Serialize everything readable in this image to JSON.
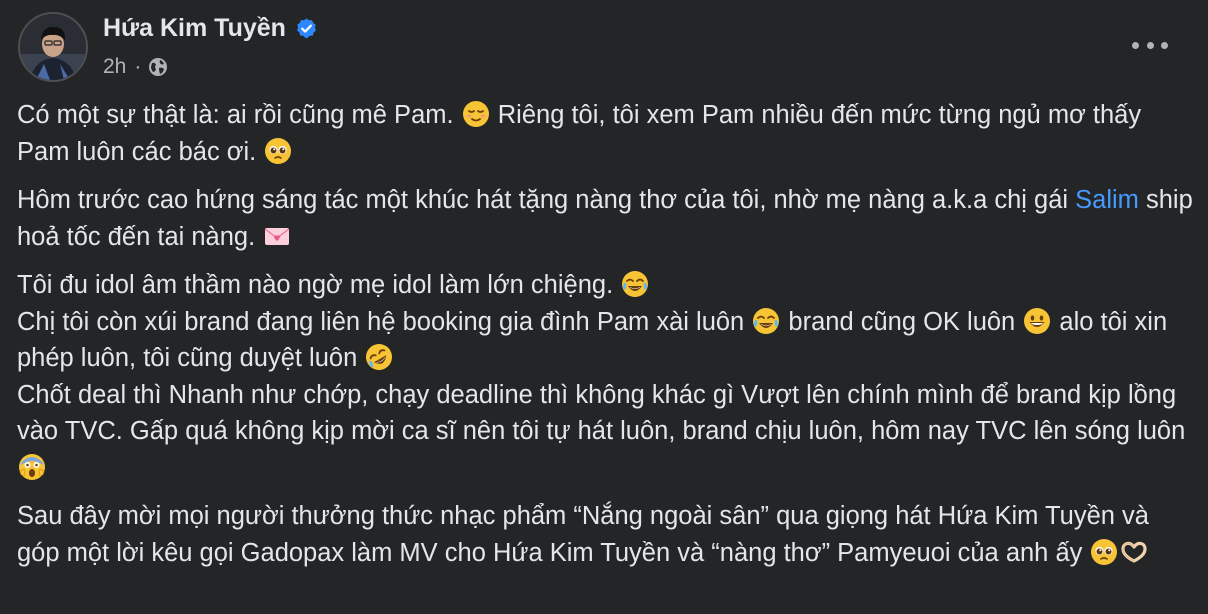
{
  "post": {
    "author": "Hứa Kim Tuyền",
    "verified": true,
    "time": "2h",
    "separator": "·",
    "audience_icon": "globe-icon",
    "more_icon": "more-options-icon",
    "mention_color": "#4599ff",
    "accent_verified": "#2d88ff"
  },
  "body": {
    "p1_a": "Có một sự thật là: ai rồi cũng mê Pam. ",
    "p1_b": " Riêng tôi, tôi xem Pam nhiều đến mức từng ngủ mơ thấy Pam luôn các bác ơi. ",
    "p2_a": "Hôm trước cao hứng sáng tác một khúc hát tặng nàng thơ của tôi, nhờ mẹ nàng a.k.a chị gái ",
    "p2_mention": "Salim",
    "p2_b": " ship hoả tốc đến tai nàng. ",
    "p3_l1": "Tôi đu idol âm thầm nào ngờ mẹ idol làm lớn chiệng. ",
    "p3_l2a": "Chị tôi còn xúi brand đang liên hệ booking gia đình Pam xài luôn ",
    "p3_l2b": " brand cũng OK luôn ",
    "p3_l2c": " alo tôi xin phép luôn, tôi cũng duyệt luôn ",
    "p3_l3": "Chốt deal thì Nhanh như chớp, chạy deadline thì không khác gì Vượt lên chính mình để brand kịp lồng vào TVC. Gấp quá không kịp mời ca sĩ nên tôi tự hát luôn, brand chịu luôn, hôm nay TVC lên sóng luôn ",
    "p4": "Sau đây mời mọi người thưởng thức nhạc phẩm “Nắng ngoài sân” qua giọng hát Hứa Kim Tuyền và góp một lời kêu gọi Gadopax làm MV cho Hứa Kim Tuyền và “nàng thơ” Pamyeuoi của anh ấy "
  },
  "emojis": {
    "relieved": "relieved-face-emoji",
    "pleading": "pleading-face-emoji",
    "love_letter": "love-letter-emoji",
    "tears_of_joy": "face-with-tears-of-joy-emoji",
    "grinning": "grinning-face-emoji",
    "rofl": "rolling-on-floor-laughing-emoji",
    "scream": "face-screaming-in-fear-emoji",
    "heart_hands": "heart-hands-emoji"
  }
}
